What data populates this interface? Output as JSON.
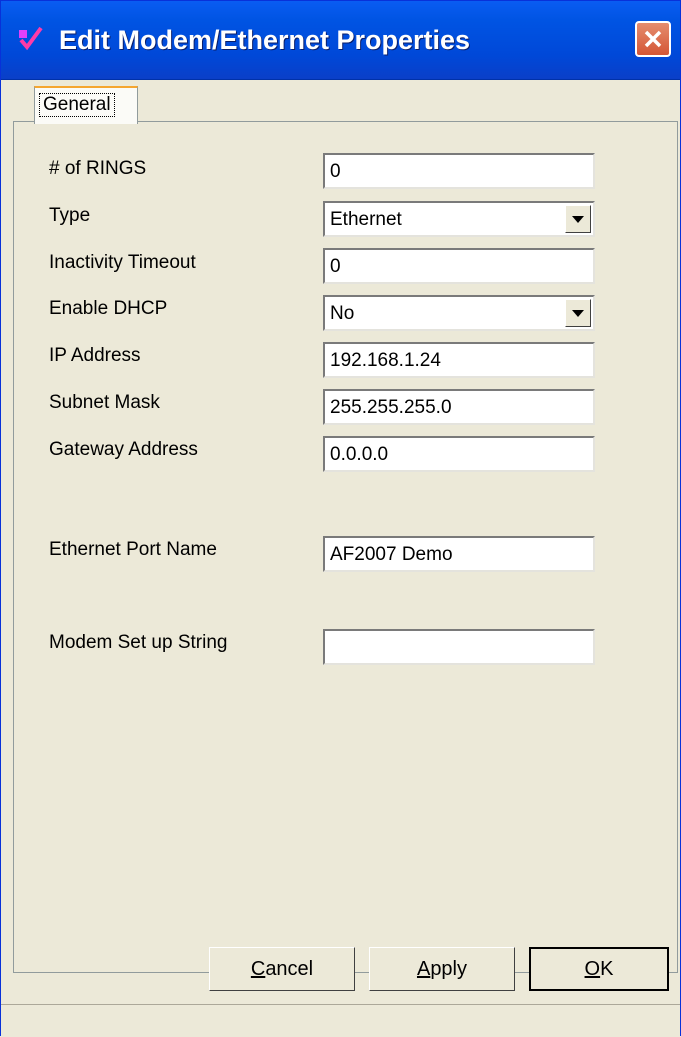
{
  "window": {
    "title": "Edit Modem/Ethernet Properties",
    "close_icon": "close-icon",
    "app_icon": "checkmark-app-icon"
  },
  "tabs": [
    {
      "label": "General",
      "selected": true
    }
  ],
  "fields": [
    {
      "label": "# of RINGS",
      "value": "0",
      "kind": "text"
    },
    {
      "label": "Type",
      "value": "Ethernet",
      "kind": "dropdown"
    },
    {
      "label": "Inactivity Timeout",
      "value": "0",
      "kind": "text"
    },
    {
      "label": "Enable DHCP",
      "value": "No",
      "kind": "dropdown"
    },
    {
      "label": "IP Address",
      "value": "192.168.1.24",
      "kind": "text"
    },
    {
      "label": "Subnet Mask",
      "value": "255.255.255.0",
      "kind": "text"
    },
    {
      "label": "Gateway Address",
      "value": "0.0.0.0",
      "kind": "text"
    },
    {
      "label": "Ethernet Port Name",
      "value": "AF2007 Demo",
      "kind": "text"
    },
    {
      "label": "Modem Set up String",
      "value": "",
      "kind": "text"
    }
  ],
  "buttons": {
    "cancel": {
      "mnemonic": "C",
      "rest": "ancel"
    },
    "apply": {
      "mnemonic": "A",
      "rest": "pply"
    },
    "ok": {
      "mnemonic": "O",
      "rest": "K"
    }
  }
}
